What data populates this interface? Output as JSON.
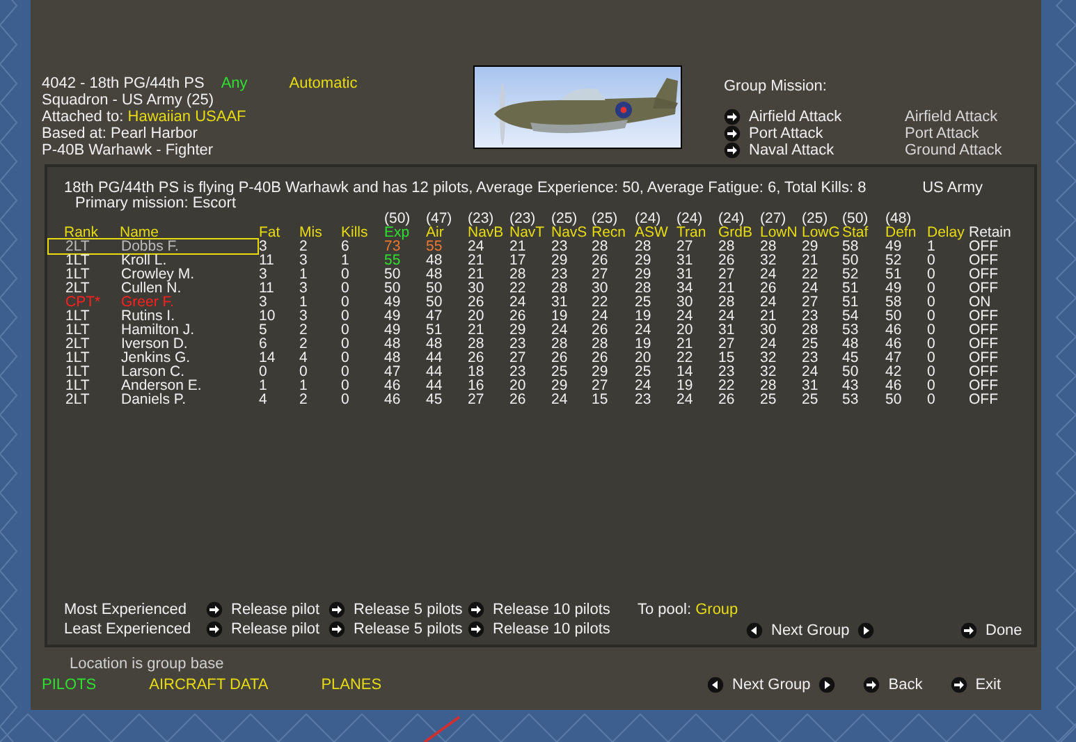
{
  "header": {
    "unit": "4042 - 18th PG/44th PS",
    "mode": "Any",
    "control": "Automatic",
    "lines": [
      {
        "label": "Squadron - US Army (25)"
      },
      {
        "label": "Attached to:",
        "value": "Hawaiian USAAF",
        "kind": "link"
      },
      {
        "label": "Based at:",
        "value": "Pearl Harbor",
        "kind": "plain"
      },
      {
        "label": "P-40B Warhawk - Fighter"
      }
    ]
  },
  "group_mission": {
    "title": "Group Mission:",
    "options": [
      {
        "label": "Airfield Attack",
        "current": "Airfield Attack"
      },
      {
        "label": "Port Attack",
        "current": "Port Attack"
      },
      {
        "label": "Naval Attack",
        "current": "Ground Attack"
      }
    ]
  },
  "pilot_dialog": {
    "summary": "18th PG/44th PS is flying P-40B Warhawk and has 12 pilots,  Average Experience: 50, Average Fatigue: 6, Total Kills: 8",
    "service": "US Army",
    "primary_mission": "Primary mission: Escort",
    "columns": [
      {
        "label": "Rank",
        "color": "#e8dc10"
      },
      {
        "label": "Name",
        "color": "#e8dc10"
      },
      {
        "label": "Fat",
        "color": "#e8dc10"
      },
      {
        "label": "Mis",
        "color": "#e8dc10"
      },
      {
        "label": "Kills",
        "color": "#e8dc10"
      },
      {
        "label": "Exp",
        "average": "(50)",
        "color": "#30e030"
      },
      {
        "label": "Air",
        "average": "(47)",
        "color": "#e8dc10"
      },
      {
        "label": "NavB",
        "average": "(23)",
        "color": "#e8dc10"
      },
      {
        "label": "NavT",
        "average": "(23)",
        "color": "#e8dc10"
      },
      {
        "label": "NavS",
        "average": "(25)",
        "color": "#e8dc10"
      },
      {
        "label": "Recn",
        "average": "(25)",
        "color": "#e8dc10"
      },
      {
        "label": "ASW",
        "average": "(24)",
        "color": "#e8dc10"
      },
      {
        "label": "Tran",
        "average": "(24)",
        "color": "#e8dc10"
      },
      {
        "label": "GrdB",
        "average": "(24)",
        "color": "#e8dc10"
      },
      {
        "label": "LowN",
        "average": "(27)",
        "color": "#e8dc10"
      },
      {
        "label": "LowG",
        "average": "(25)",
        "color": "#e8dc10"
      },
      {
        "label": "Staf",
        "average": "(50)",
        "color": "#e8dc10"
      },
      {
        "label": "Defn",
        "average": "(48)",
        "color": "#e8dc10"
      },
      {
        "label": "Delay",
        "color": "#e8dc10"
      },
      {
        "label": "Retain",
        "color": "#f0f0f0"
      }
    ],
    "rows": [
      {
        "rank": "2LT",
        "name": "Dobbs F.",
        "selected": true,
        "kind": "pilot",
        "values": [
          "3",
          "2",
          "6",
          {
            "text": "73",
            "color": "#f07830"
          },
          {
            "text": "55",
            "color": "#f07830"
          },
          "24",
          "21",
          "23",
          "28",
          "28",
          "27",
          "28",
          "28",
          "29",
          "58",
          "49",
          "1",
          "OFF"
        ]
      },
      {
        "rank": "1LT",
        "name": "Kroll L.",
        "selected": false,
        "kind": "pilot",
        "values": [
          "11",
          "3",
          "1",
          {
            "text": "55",
            "color": "#30e030"
          },
          "48",
          "21",
          "17",
          "29",
          "26",
          "29",
          "31",
          "26",
          "32",
          "21",
          "50",
          "52",
          "0",
          "OFF"
        ]
      },
      {
        "rank": "1LT",
        "name": "Crowley M.",
        "selected": false,
        "kind": "pilot",
        "values": [
          "3",
          "1",
          "0",
          "50",
          "48",
          "21",
          "28",
          "23",
          "27",
          "29",
          "31",
          "27",
          "24",
          "22",
          "52",
          "51",
          "0",
          "OFF"
        ]
      },
      {
        "rank": "2LT",
        "name": "Cullen N.",
        "selected": false,
        "kind": "pilot",
        "values": [
          "11",
          "3",
          "0",
          "50",
          "50",
          "30",
          "22",
          "28",
          "30",
          "28",
          "34",
          "21",
          "26",
          "24",
          "51",
          "49",
          "0",
          "OFF"
        ]
      },
      {
        "rank": "CPT*",
        "name": "Greer F.",
        "selected": false,
        "kind": "commander",
        "values": [
          "3",
          "1",
          "0",
          "49",
          "50",
          "26",
          "24",
          "31",
          "22",
          "25",
          "30",
          "28",
          "24",
          "27",
          "51",
          "58",
          "0",
          "ON"
        ]
      },
      {
        "rank": "1LT",
        "name": "Rutins I.",
        "selected": false,
        "kind": "pilot",
        "values": [
          "10",
          "3",
          "0",
          "49",
          "47",
          "20",
          "26",
          "19",
          "24",
          "19",
          "24",
          "24",
          "21",
          "23",
          "54",
          "50",
          "0",
          "OFF"
        ]
      },
      {
        "rank": "1LT",
        "name": "Hamilton J.",
        "selected": false,
        "kind": "pilot",
        "values": [
          "5",
          "2",
          "0",
          "49",
          "51",
          "21",
          "29",
          "24",
          "26",
          "24",
          "20",
          "31",
          "30",
          "28",
          "53",
          "46",
          "0",
          "OFF"
        ]
      },
      {
        "rank": "2LT",
        "name": "Iverson D.",
        "selected": false,
        "kind": "pilot",
        "values": [
          "6",
          "2",
          "0",
          "48",
          "48",
          "28",
          "23",
          "28",
          "28",
          "19",
          "21",
          "27",
          "24",
          "25",
          "48",
          "46",
          "0",
          "OFF"
        ]
      },
      {
        "rank": "1LT",
        "name": "Jenkins G.",
        "selected": false,
        "kind": "pilot",
        "values": [
          "14",
          "4",
          "0",
          "48",
          "44",
          "26",
          "27",
          "26",
          "26",
          "20",
          "22",
          "15",
          "32",
          "23",
          "45",
          "47",
          "0",
          "OFF"
        ]
      },
      {
        "rank": "1LT",
        "name": "Larson C.",
        "selected": false,
        "kind": "pilot",
        "values": [
          "0",
          "0",
          "0",
          "47",
          "44",
          "18",
          "23",
          "25",
          "29",
          "25",
          "14",
          "23",
          "32",
          "24",
          "50",
          "42",
          "0",
          "OFF"
        ]
      },
      {
        "rank": "1LT",
        "name": "Anderson E.",
        "selected": false,
        "kind": "pilot",
        "values": [
          "1",
          "1",
          "0",
          "46",
          "44",
          "16",
          "20",
          "29",
          "27",
          "24",
          "19",
          "22",
          "28",
          "31",
          "43",
          "46",
          "0",
          "OFF"
        ]
      },
      {
        "rank": "2LT",
        "name": "Daniels P.",
        "selected": false,
        "kind": "pilot",
        "values": [
          "4",
          "2",
          "0",
          "46",
          "45",
          "27",
          "26",
          "24",
          "15",
          "23",
          "24",
          "26",
          "25",
          "25",
          "53",
          "50",
          "0",
          "OFF"
        ]
      }
    ],
    "release_rows": [
      {
        "label": "Most Experienced",
        "buttons": [
          "Release pilot",
          "Release 5 pilots",
          "Release 10 pilots"
        ]
      },
      {
        "label": "Least Experienced",
        "buttons": [
          "Release pilot",
          "Release 5 pilots",
          "Release 10 pilots"
        ]
      }
    ],
    "to_pool": {
      "label": "To pool:",
      "value": "Group"
    },
    "next_group": "Next Group",
    "done": "Done"
  },
  "location_note": "Location is group base",
  "tabs": [
    {
      "label": "PILOTS",
      "selected": true
    },
    {
      "label": "AIRCRAFT DATA",
      "selected": false
    },
    {
      "label": "PLANES",
      "selected": false
    }
  ],
  "nav": {
    "next_group": "Next Group",
    "back": "Back",
    "exit": "Exit"
  }
}
